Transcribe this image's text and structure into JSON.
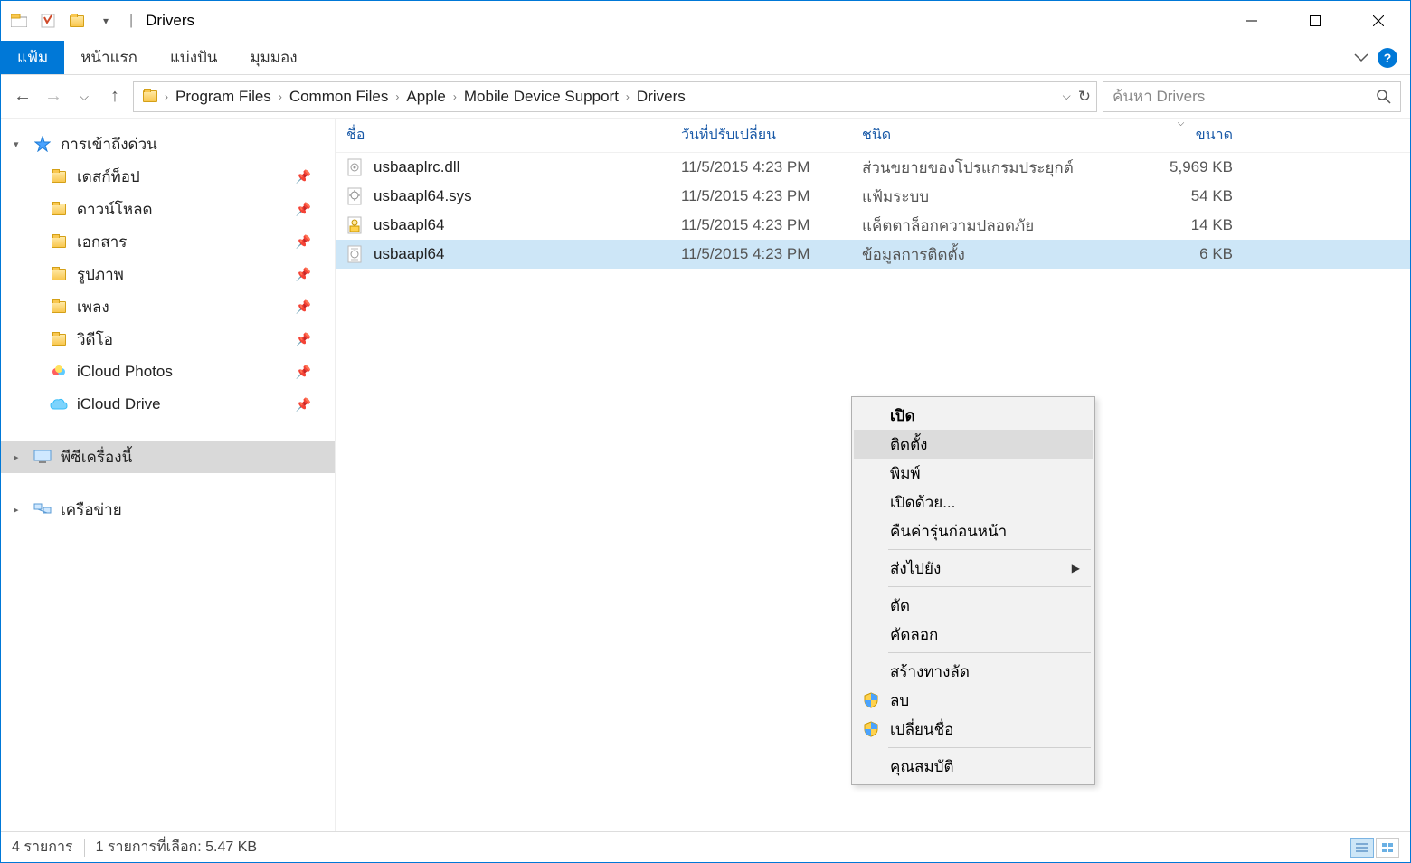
{
  "title": "Drivers",
  "ribbon": {
    "file": "แฟ้ม",
    "tabs": [
      "หน้าแรก",
      "แบ่งปัน",
      "มุมมอง"
    ]
  },
  "breadcrumb": [
    "Program Files",
    "Common Files",
    "Apple",
    "Mobile Device Support",
    "Drivers"
  ],
  "search_placeholder": "ค้นหา Drivers",
  "nav": {
    "quick_access": "การเข้าถึงด่วน",
    "items": [
      {
        "label": "เดสก์ท็อป",
        "pin": true
      },
      {
        "label": "ดาวน์โหลด",
        "pin": true
      },
      {
        "label": "เอกสาร",
        "pin": true
      },
      {
        "label": "รูปภาพ",
        "pin": true
      },
      {
        "label": "เพลง",
        "pin": true
      },
      {
        "label": "วิดีโอ",
        "pin": true
      },
      {
        "label": "iCloud Photos",
        "pin": true
      },
      {
        "label": "iCloud Drive",
        "pin": true
      }
    ],
    "this_pc": "พีซีเครื่องนี้",
    "network": "เครือข่าย"
  },
  "columns": {
    "name": "ชื่อ",
    "date": "วันที่ปรับเปลี่ยน",
    "type": "ชนิด",
    "size": "ขนาด"
  },
  "files": [
    {
      "name": "usbaaplrc.dll",
      "date": "11/5/2015 4:23 PM",
      "type": "ส่วนขยายของโปรแกรมประยุกต์",
      "size": "5,969 KB",
      "icon": "dll"
    },
    {
      "name": "usbaapl64.sys",
      "date": "11/5/2015 4:23 PM",
      "type": "แฟ้มระบบ",
      "size": "54 KB",
      "icon": "sys"
    },
    {
      "name": "usbaapl64",
      "date": "11/5/2015 4:23 PM",
      "type": "แค็ตตาล็อกความปลอดภัย",
      "size": "14 KB",
      "icon": "cat"
    },
    {
      "name": "usbaapl64",
      "date": "11/5/2015 4:23 PM",
      "type": "ข้อมูลการติดตั้ง",
      "size": "6 KB",
      "icon": "inf",
      "selected": true
    }
  ],
  "context_menu": {
    "open": "เปิด",
    "install": "ติดตั้ง",
    "print": "พิมพ์",
    "open_with": "เปิดด้วย...",
    "restore": "คืนค่ารุ่นก่อนหน้า",
    "send_to": "ส่งไปยัง",
    "cut": "ตัด",
    "copy": "คัดลอก",
    "shortcut": "สร้างทางลัด",
    "delete": "ลบ",
    "rename": "เปลี่ยนชื่อ",
    "properties": "คุณสมบัติ"
  },
  "status": {
    "count": "4 รายการ",
    "selection": "1 รายการที่เลือก: 5.47 KB"
  }
}
